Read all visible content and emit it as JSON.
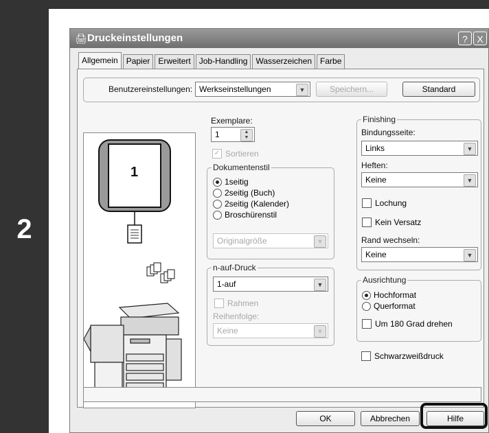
{
  "step_number": "2",
  "dialog": {
    "title": "Druckeinstellungen",
    "title_icon": "printer-icon",
    "help_glyph": "?",
    "close_glyph": "X"
  },
  "tabs": [
    {
      "label": "Allgemein",
      "active": true
    },
    {
      "label": "Papier"
    },
    {
      "label": "Erweitert"
    },
    {
      "label": "Job-Handling"
    },
    {
      "label": "Wasserzeichen"
    },
    {
      "label": "Farbe"
    }
  ],
  "user_settings": {
    "label": "Benutzereinstellungen:",
    "value": "Werkseinstellungen",
    "save_label": "Speichern...",
    "standard_label": "Standard"
  },
  "preview": {
    "page_number": "1"
  },
  "copies": {
    "label": "Exemplare:",
    "value": "1",
    "collate_label": "Sortieren"
  },
  "document_style": {
    "legend": "Dokumentenstil",
    "options": [
      "1seitig",
      "2seitig (Buch)",
      "2seitig (Kalender)",
      "Broschürenstil"
    ],
    "selected": "1seitig",
    "booklet_size": "Originalgröße"
  },
  "n_up": {
    "legend": "n-auf-Druck",
    "value": "1-auf",
    "border_label": "Rahmen",
    "order_label": "Reihenfolge:",
    "order_value": "Keine"
  },
  "finishing": {
    "legend": "Finishing",
    "binding_label": "Bindungsseite:",
    "binding_value": "Links",
    "staple_label": "Heften:",
    "staple_value": "Keine",
    "punch_label": "Lochung",
    "offset_label": "Kein Versatz",
    "margin_label": "Rand wechseln:",
    "margin_value": "Keine"
  },
  "orientation": {
    "legend": "Ausrichtung",
    "options": [
      "Hochformat",
      "Querformat"
    ],
    "selected": "Hochformat",
    "rotate_label": "Um 180 Grad drehen"
  },
  "bw_label": "Schwarzweißdruck",
  "buttons": {
    "ok": "OK",
    "cancel": "Abbrechen",
    "help": "Hilfe"
  }
}
